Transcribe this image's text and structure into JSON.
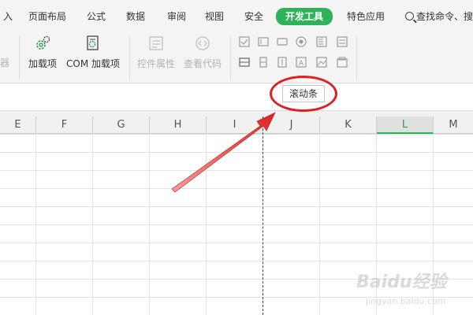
{
  "menu": {
    "items": [
      "入",
      "页面布局",
      "公式",
      "数据",
      "审阅",
      "视图",
      "安全",
      "开发工具",
      "特色应用"
    ],
    "active_index": 7,
    "search_label": "查找命令、搜"
  },
  "ribbon": {
    "cut_label": "器",
    "addins_label": "加载项",
    "com_addins_label": "COM 加载项",
    "control_props_label": "控件属性",
    "view_code_label": "查看代码"
  },
  "tooltip": {
    "text": "滚动条"
  },
  "sheet": {
    "columns": [
      "E",
      "F",
      "G",
      "H",
      "I",
      "J",
      "K",
      "L",
      "M"
    ],
    "selected_column": "L"
  },
  "colors": {
    "accent": "#2eb35a",
    "annotation": "#e02020"
  },
  "watermark": {
    "brand": "Baidu经验",
    "sub": "jingyan.baidu.com"
  }
}
